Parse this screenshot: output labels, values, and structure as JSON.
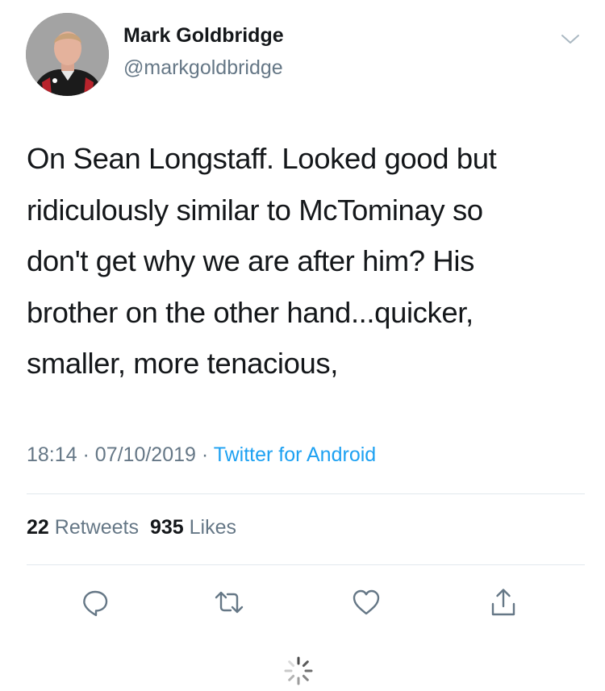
{
  "tweet": {
    "author": {
      "display_name": "Mark Goldbridge",
      "handle": "@markgoldbridge",
      "avatar_icon": "profile-photo"
    },
    "text_lines": [
      "On Sean Longstaff. Looked good but",
      "ridiculously similar to McTominay so",
      "don't get why we are after him? His",
      "brother on the other hand...quicker,",
      "smaller, more tenacious,"
    ],
    "time": "18:14",
    "date": "07/10/2019",
    "separator": "·",
    "source": "Twitter for Android",
    "stats": {
      "retweets_count": "22",
      "retweets_label": "Retweets",
      "likes_count": "935",
      "likes_label": "Likes"
    },
    "actions": [
      "reply-icon",
      "retweet-icon",
      "like-icon",
      "share-icon"
    ]
  },
  "colors": {
    "text": "#14171a",
    "secondary": "#657786",
    "link": "#1da1f2",
    "divider": "#e1e8ed"
  }
}
